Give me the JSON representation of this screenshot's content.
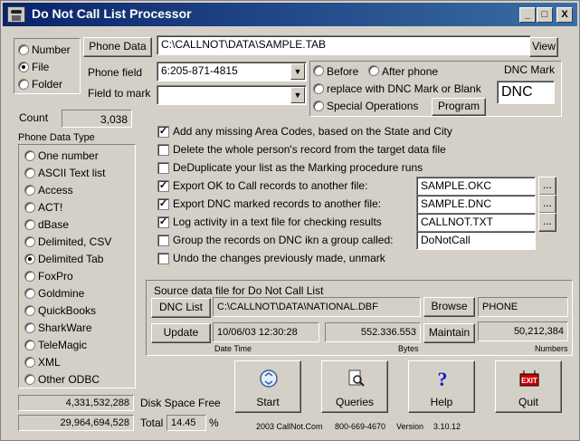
{
  "window": {
    "title": "Do Not Call List Processor",
    "min": "_",
    "max": "□",
    "close": "X"
  },
  "mode_options": [
    "Number",
    "File",
    "Folder"
  ],
  "phone_data": {
    "button": "Phone Data",
    "value": "C:\\CALLNOT\\DATA\\SAMPLE.TAB",
    "view": "View"
  },
  "phone_field": {
    "label": "Phone field",
    "value": "6:205-871-4815"
  },
  "field_to_mark": {
    "label": "Field to mark",
    "value": ""
  },
  "placement": {
    "before": "Before",
    "after": "After phone",
    "replace": "replace with DNC Mark or Blank",
    "special": "Special Operations",
    "program": "Program"
  },
  "dnc_mark": {
    "label": "DNC Mark",
    "value": "DNC"
  },
  "count": {
    "label": "Count",
    "value": "3,038"
  },
  "types": {
    "label": "Phone Data Type",
    "items": [
      "One number",
      "ASCII Text list",
      "Access",
      "ACT!",
      "dBase",
      "Delimited, CSV",
      "Delimited  Tab",
      "FoxPro",
      "Goldmine",
      "QuickBooks",
      "SharkWare",
      "TeleMagic",
      "XML",
      "Other ODBC"
    ]
  },
  "options": [
    {
      "label": "Add any missing Area Codes, based on the State and City"
    },
    {
      "label": "Delete the whole person's record from the target data file"
    },
    {
      "label": "DeDuplicate your list as the Marking procedure runs"
    },
    {
      "label": "Export OK to Call records to another file:",
      "file": "SAMPLE.OKC",
      "browse": "..."
    },
    {
      "label": "Export DNC marked records to another file:",
      "file": "SAMPLE.DNC",
      "browse": "..."
    },
    {
      "label": "Log activity in a text file for checking results",
      "file": "CALLNOT.TXT",
      "browse": "..."
    },
    {
      "label": "Group the records on DNC ikn a group called:",
      "file": "DoNotCall"
    },
    {
      "label": "Undo the changes previously made, unmark"
    }
  ],
  "source": {
    "title": "Source data file for Do Not Call List",
    "dnc_list": "DNC List",
    "path": "C:\\CALLNOT\\DATA\\NATIONAL.DBF",
    "browse": "Browse",
    "field": "PHONE",
    "update": "Update",
    "datetime": "10/06/03 12:30:28",
    "bytes": "552.336.553",
    "maintain": "Maintain",
    "numbers": "50,212,384",
    "datetime_caption": "Date Time",
    "bytes_caption": "Bytes",
    "numbers_caption": "Numbers"
  },
  "disk": {
    "free_value": "4,331,532,288",
    "free_label": "Disk Space Free",
    "total_value": "29,964,694,528",
    "total_label": "Total",
    "pct": "14.45",
    "pct_sign": "%"
  },
  "actions": {
    "start": "Start",
    "queries": "Queries",
    "help": "Help",
    "quit": "Quit",
    "exit_sign": "EXIT"
  },
  "footer": {
    "copyright": "2003 CallNot.Com",
    "phone": "800-669-4670",
    "version_label": "Version",
    "version": "3.10.12"
  },
  "colors": {
    "title_start": "#0a246a",
    "title_end": "#3a6ea5",
    "face": "#d4d0c8",
    "exit_red": "#cc0000",
    "help_blue": "#1a1acc"
  }
}
